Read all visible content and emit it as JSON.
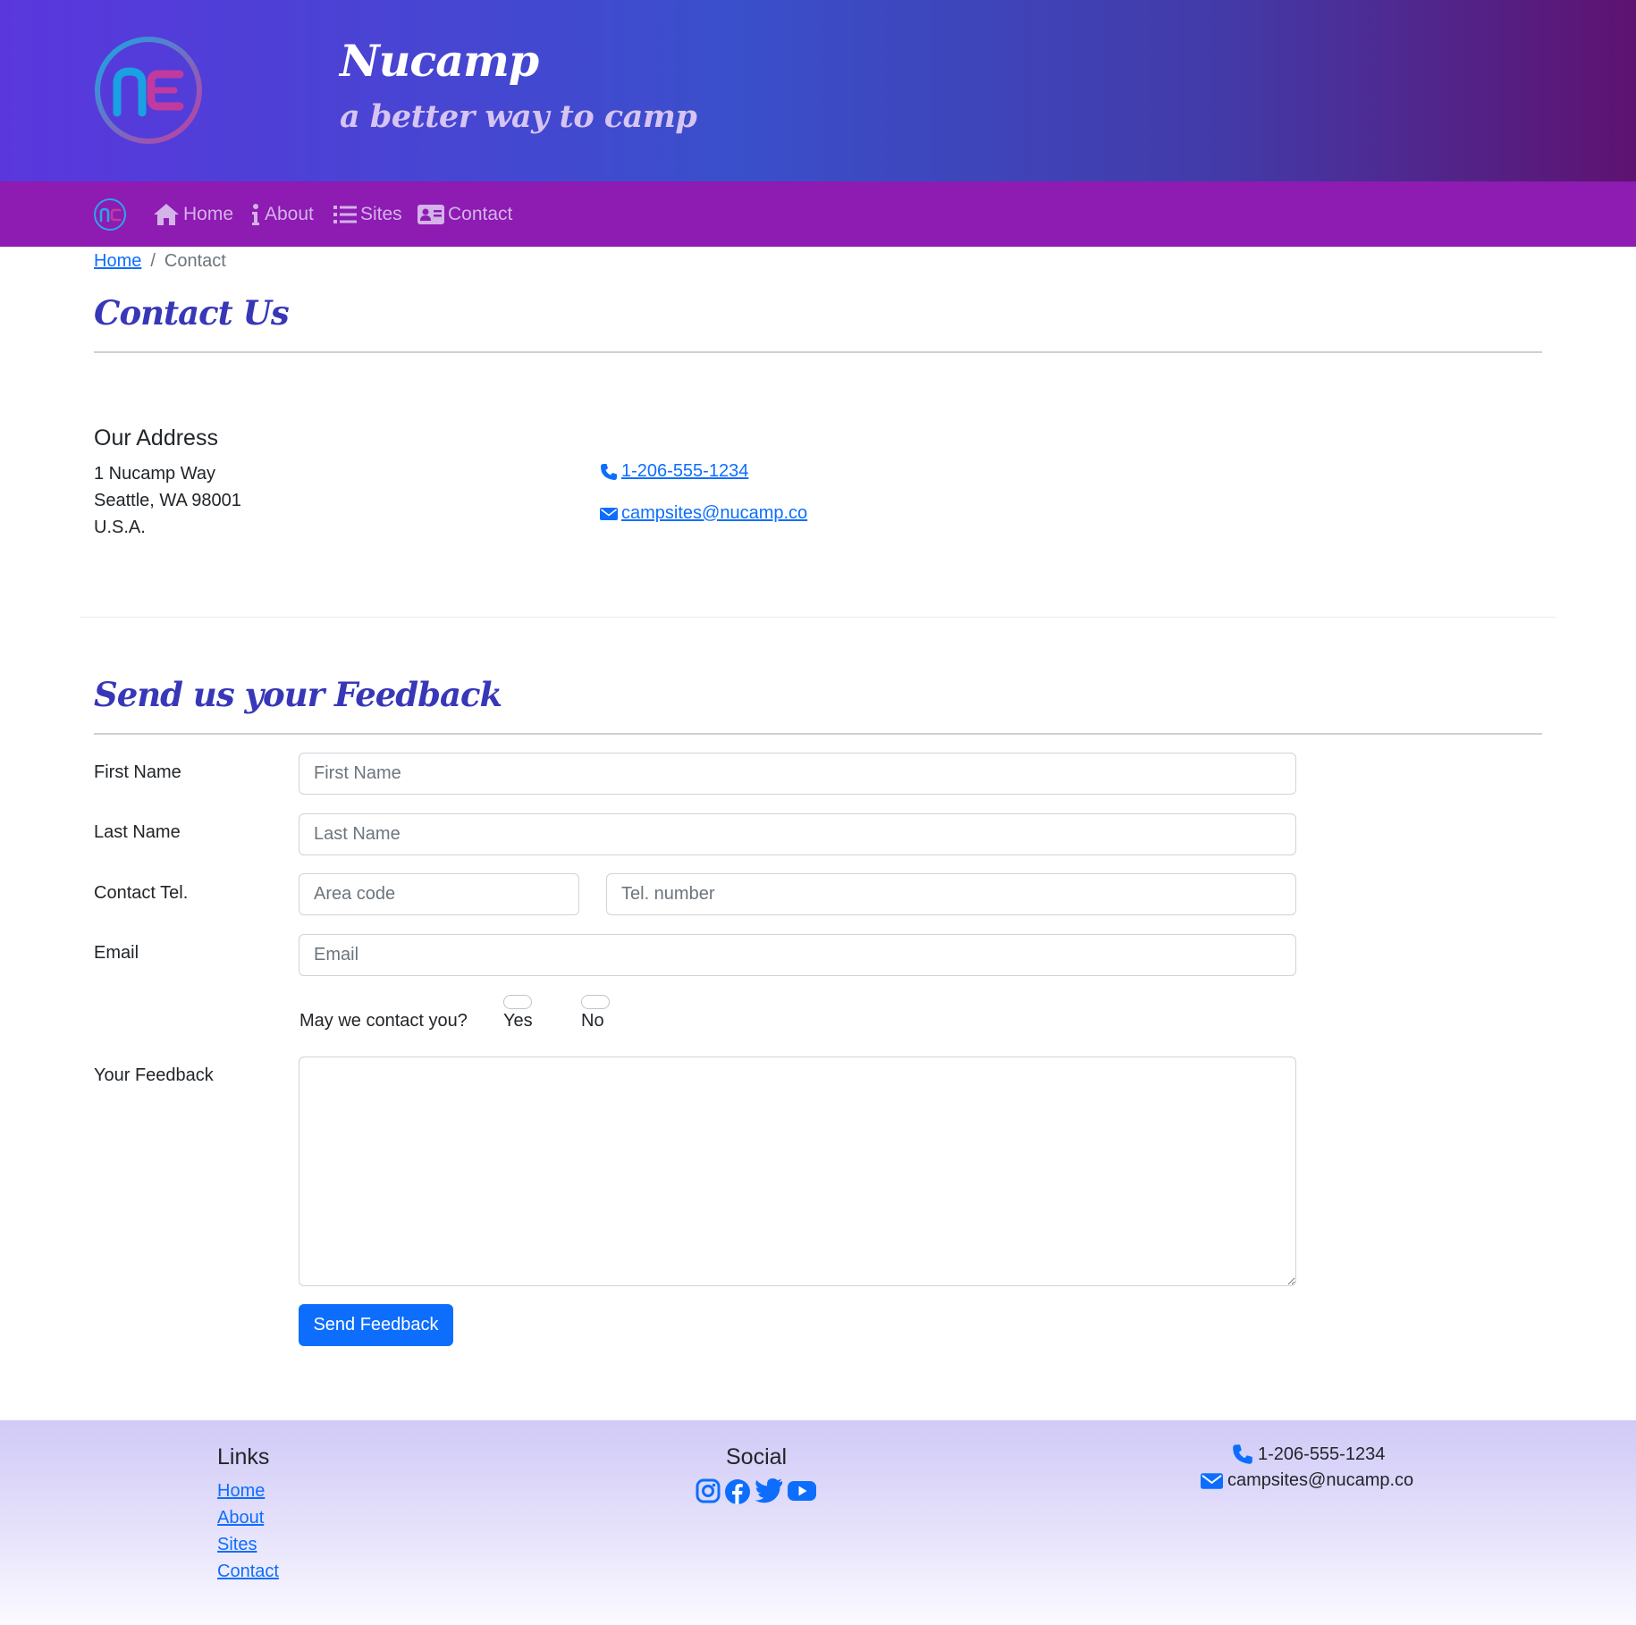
{
  "header": {
    "brand": "Nucamp",
    "tagline": "a better way to camp"
  },
  "nav": {
    "items": [
      {
        "label": "Home",
        "icon": "home-icon"
      },
      {
        "label": "About",
        "icon": "info-icon"
      },
      {
        "label": "Sites",
        "icon": "list-icon"
      },
      {
        "label": "Contact",
        "icon": "address-card-icon"
      }
    ]
  },
  "breadcrumb": {
    "home": "Home",
    "separator": "/",
    "current": "Contact"
  },
  "contact": {
    "title": "Contact Us",
    "address_heading": "Our Address",
    "address_lines": [
      "1 Nucamp Way",
      "Seattle, WA 98001",
      "U.S.A."
    ],
    "phone": " 1-206-555-1234",
    "email": " campsites@nucamp.co"
  },
  "feedback": {
    "title": "Send us your Feedback",
    "first_name_label": "First Name",
    "first_name_placeholder": "First Name",
    "last_name_label": "Last Name",
    "last_name_placeholder": "Last Name",
    "tel_label": "Contact Tel.",
    "area_code_placeholder": "Area code",
    "tel_number_placeholder": "Tel. number",
    "email_label": "Email",
    "email_placeholder": "Email",
    "may_contact_label": "May we contact you?",
    "yes_label": "Yes",
    "no_label": "No",
    "feedback_label": "Your Feedback",
    "submit_label": "Send Feedback"
  },
  "footer": {
    "links_heading": "Links",
    "links": [
      "Home",
      "About",
      "Sites",
      "Contact"
    ],
    "social_heading": "Social",
    "social_icons": [
      "instagram-icon",
      "facebook-icon",
      "twitter-icon",
      "youtube-icon"
    ],
    "phone": "1-206-555-1234",
    "email": "campsites@nucamp.co"
  },
  "colors": {
    "primary": "#0d6efd",
    "navbar": "#8e1bb2",
    "title": "#3737b8"
  }
}
